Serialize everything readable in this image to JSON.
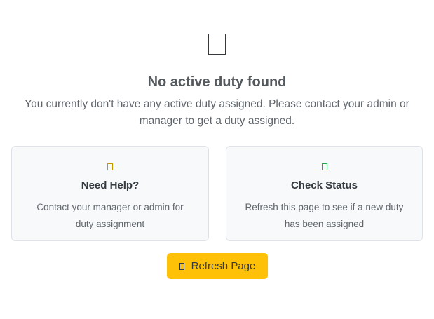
{
  "empty_state": {
    "icon": "clipboard-icon",
    "title": "No active duty found",
    "message": "You currently don't have any active duty assigned. Please contact your admin or manager to get a duty assigned."
  },
  "cards": [
    {
      "icon": "help-icon",
      "icon_color": "#c69500",
      "title": "Need Help?",
      "text": "Contact your manager or admin for duty assignment"
    },
    {
      "icon": "check-icon",
      "icon_color": "#28a745",
      "title": "Check Status",
      "text": "Refresh this page to see if a new duty has been assigned"
    }
  ],
  "refresh_button": {
    "icon": "refresh-icon",
    "label": "Refresh Page",
    "color": "#ffc107"
  }
}
